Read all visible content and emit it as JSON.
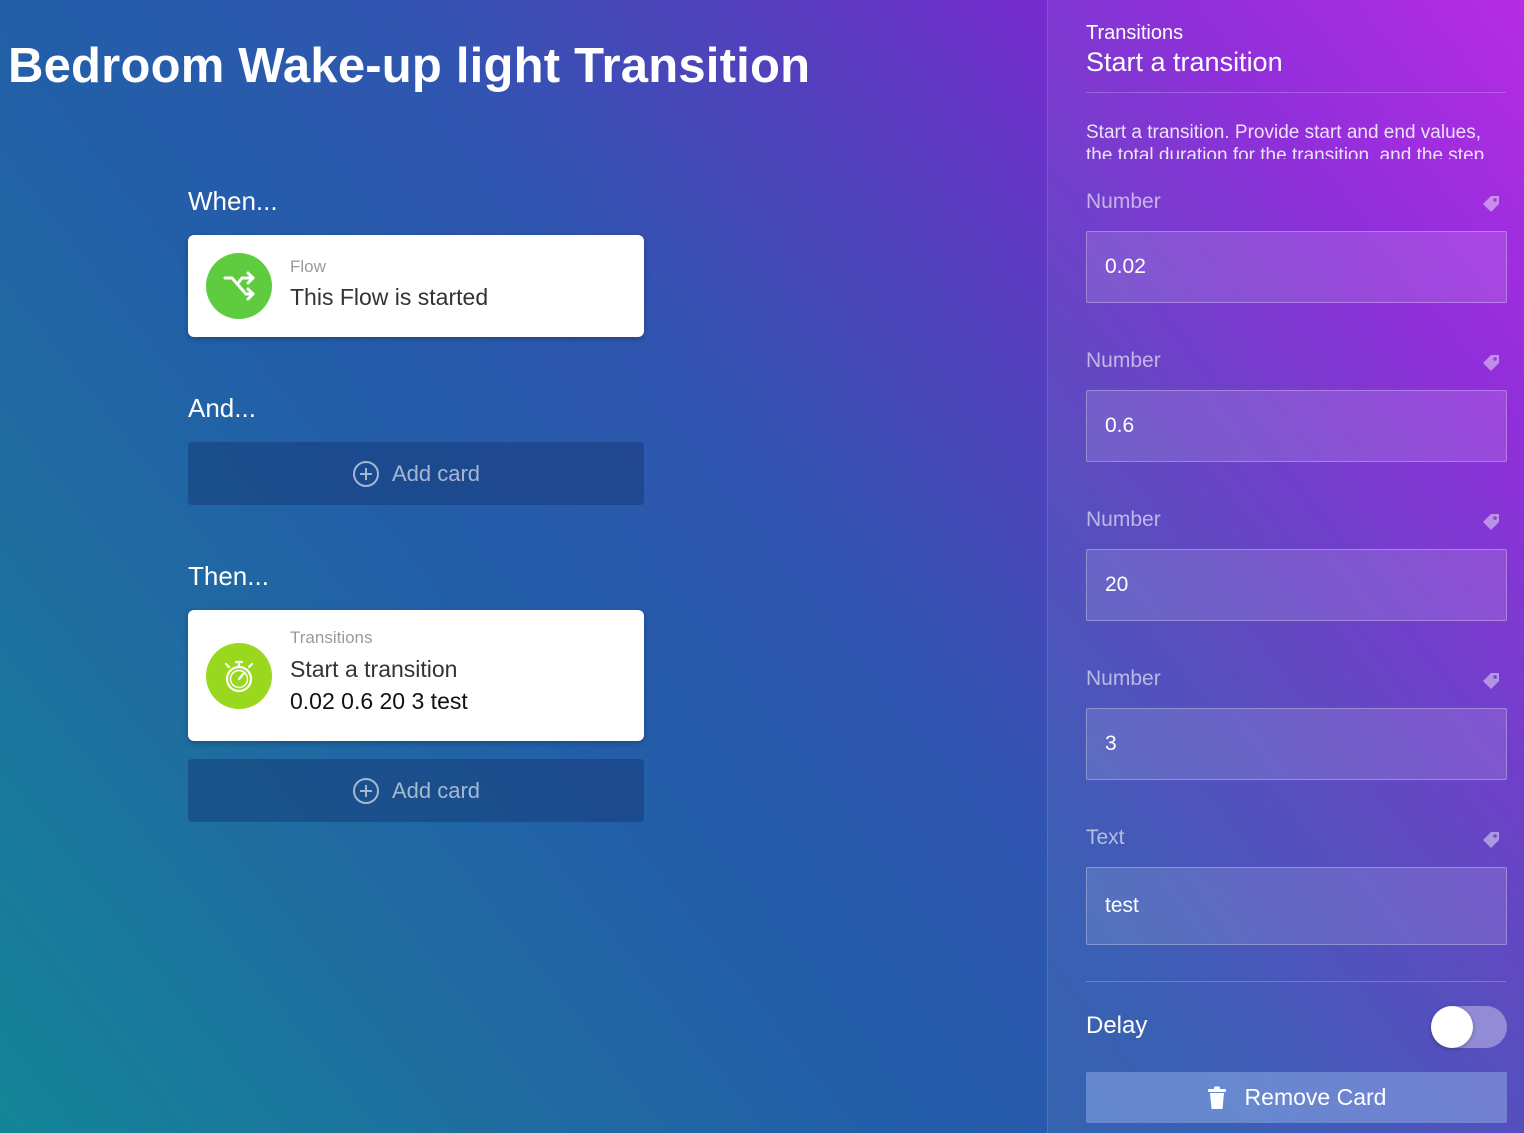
{
  "flow": {
    "title": "Bedroom Wake-up light Transition"
  },
  "sections": {
    "when_label": "When...",
    "and_label": "And...",
    "then_label": "Then..."
  },
  "when_card": {
    "owner": "Flow",
    "title": "This Flow is started",
    "icon": "shuffle-icon",
    "icon_color": "#5fcc3f"
  },
  "then_card": {
    "owner": "Transitions",
    "title": "Start a transition",
    "args": "0.02 0.6 20 3 test",
    "icon": "stopwatch-icon",
    "icon_color": "#9ad81f"
  },
  "add_card_label": "Add card",
  "panel": {
    "owner": "Transitions",
    "title": "Start a transition",
    "description": "Start a transition. Provide start and end values, the total duration for the transition, and the step",
    "fields": [
      {
        "label": "Number",
        "value": "0.02"
      },
      {
        "label": "Number",
        "value": "0.6"
      },
      {
        "label": "Number",
        "value": "20"
      },
      {
        "label": "Number",
        "value": "3"
      },
      {
        "label": "Text",
        "value": "test"
      }
    ],
    "delay_label": "Delay",
    "delay_enabled": false,
    "remove_label": "Remove Card"
  }
}
